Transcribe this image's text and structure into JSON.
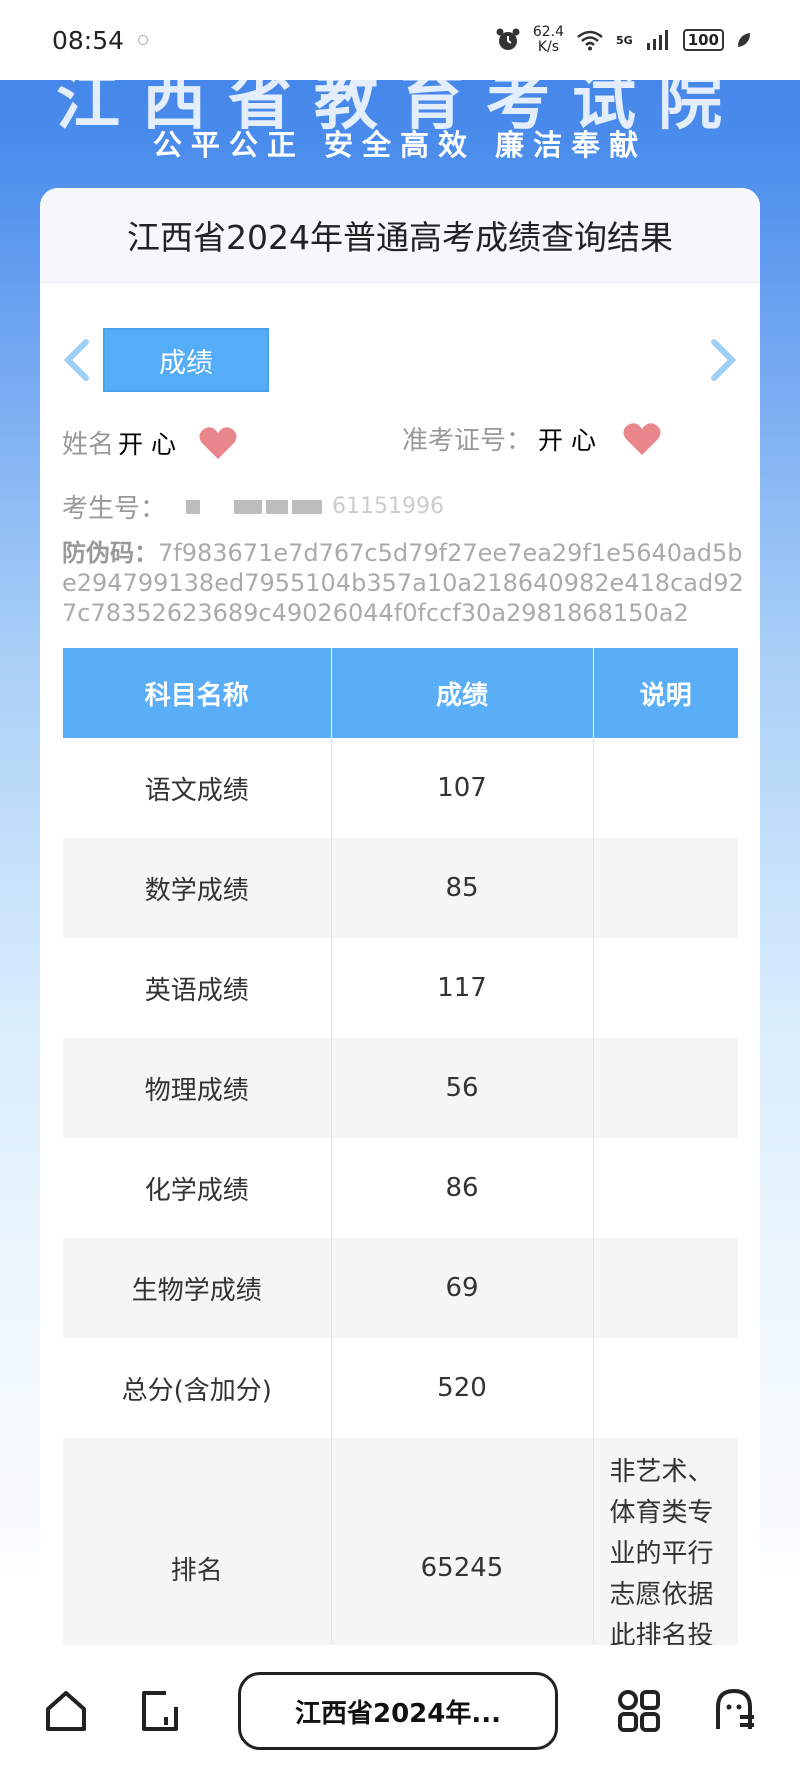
{
  "status_bar": {
    "time": "08:54",
    "net_speed_value": "62.4",
    "net_speed_unit": "K/s",
    "signal_label": "5G",
    "battery": "100"
  },
  "banner": {
    "title": "江西省教育考试院",
    "slogan": "公平公正 安全高效 廉洁奉献"
  },
  "card": {
    "title": "江西省2024年普通高考成绩查询结果",
    "active_tab": "成绩",
    "name_label": "姓名",
    "name_value": "开 心",
    "exam_no_label": "准考证号：",
    "exam_no_value": "开 心",
    "candidate_no_label": "考生号：",
    "candidate_no_value": "61151996",
    "anti_fake_label": "防伪码：",
    "anti_fake_value": "7f983671e7d767c5d79f27ee7ea29f1e5640ad5be294799138ed7955104b357a10a218640982e418cad927c78352623689c49026044f0fccf30a2981868150a2"
  },
  "table": {
    "headers": [
      "科目名称",
      "成绩",
      "说明"
    ],
    "rows": [
      {
        "subject": "语文成绩",
        "score": "107",
        "note": ""
      },
      {
        "subject": "数学成绩",
        "score": "85",
        "note": ""
      },
      {
        "subject": "英语成绩",
        "score": "117",
        "note": ""
      },
      {
        "subject": "物理成绩",
        "score": "56",
        "note": ""
      },
      {
        "subject": "化学成绩",
        "score": "86",
        "note": ""
      },
      {
        "subject": "生物学成绩",
        "score": "69",
        "note": ""
      },
      {
        "subject": "总分(含加分)",
        "score": "520",
        "note": ""
      },
      {
        "subject": "排名",
        "score": "65245",
        "note": "非艺术、体育类专业的平行志愿依据此排名投档"
      }
    ]
  },
  "bottom_nav": {
    "page_title": "江西省2024年..."
  },
  "colors": {
    "header_blue": "#5aaef7",
    "tab_blue": "#55adf7",
    "heart_pink": "#e8868c"
  }
}
